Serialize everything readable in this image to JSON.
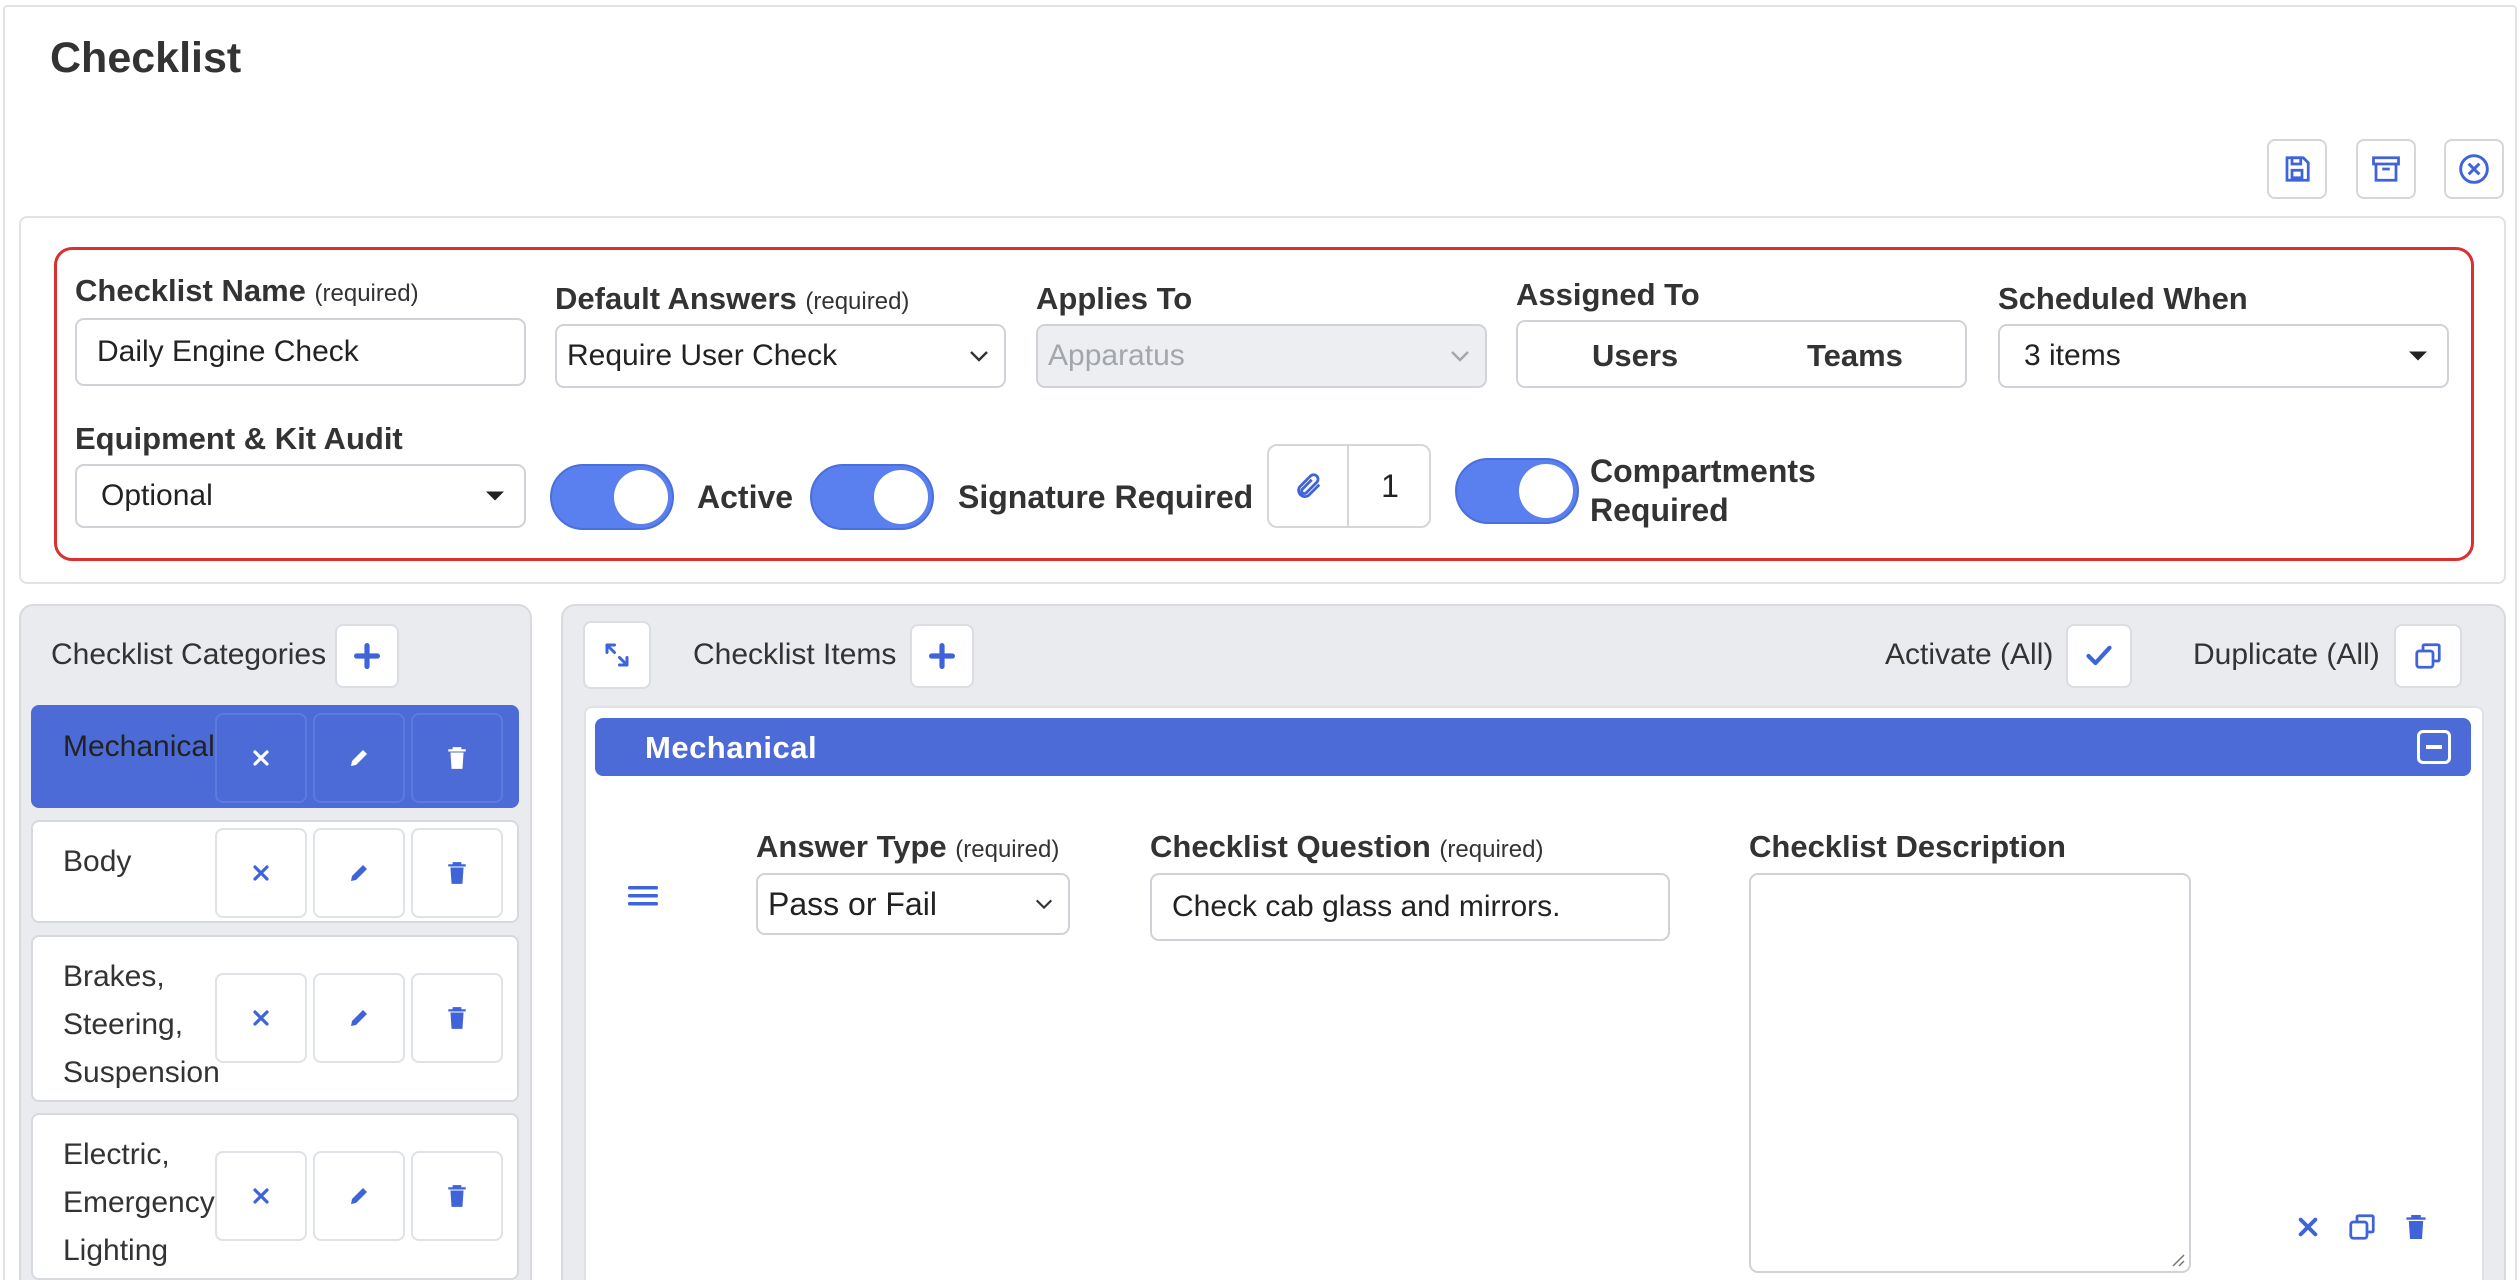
{
  "page": {
    "title": "Checklist"
  },
  "settings": {
    "checklist_name": {
      "label": "Checklist Name",
      "hint": "(required)",
      "value": "Daily Engine Check"
    },
    "default_answers": {
      "label": "Default Answers",
      "hint": "(required)",
      "value": "Require User Check"
    },
    "applies_to": {
      "label": "Applies To",
      "value": "Apparatus"
    },
    "assigned_to": {
      "label": "Assigned To",
      "users": "Users",
      "teams": "Teams"
    },
    "scheduled_when": {
      "label": "Scheduled When",
      "value": "3 items"
    },
    "equipment_audit": {
      "label": "Equipment & Kit Audit",
      "value": "Optional"
    },
    "active_label": "Active",
    "signature_label": "Signature Required",
    "attachments_count": "1",
    "compartments_label_1": "Compartments",
    "compartments_label_2": "Required"
  },
  "categories": {
    "title": "Checklist Categories",
    "items": [
      {
        "lines": [
          "Mechanical"
        ],
        "active": true
      },
      {
        "lines": [
          "Body"
        ],
        "active": false
      },
      {
        "lines": [
          "Brakes,",
          "Steering,",
          "Suspension"
        ],
        "active": false
      },
      {
        "lines": [
          "Electric,",
          "Emergency",
          "Lighting"
        ],
        "active": false
      }
    ]
  },
  "items_panel": {
    "title": "Checklist Items",
    "activate_all": "Activate (All)",
    "duplicate_all": "Duplicate (All)",
    "section_title": "Mechanical",
    "answer_type": {
      "label": "Answer Type",
      "hint": "(required)",
      "value": "Pass or Fail"
    },
    "question": {
      "label": "Checklist Question",
      "hint": "(required)",
      "value": "Check cab glass and mirrors."
    },
    "description": {
      "label": "Checklist Description",
      "value": ""
    }
  },
  "colors": {
    "accent": "#4c6bd6",
    "toggle": "#5a7fef",
    "required_border": "#dc2f2f",
    "icon_blue": "#3f63d9"
  }
}
